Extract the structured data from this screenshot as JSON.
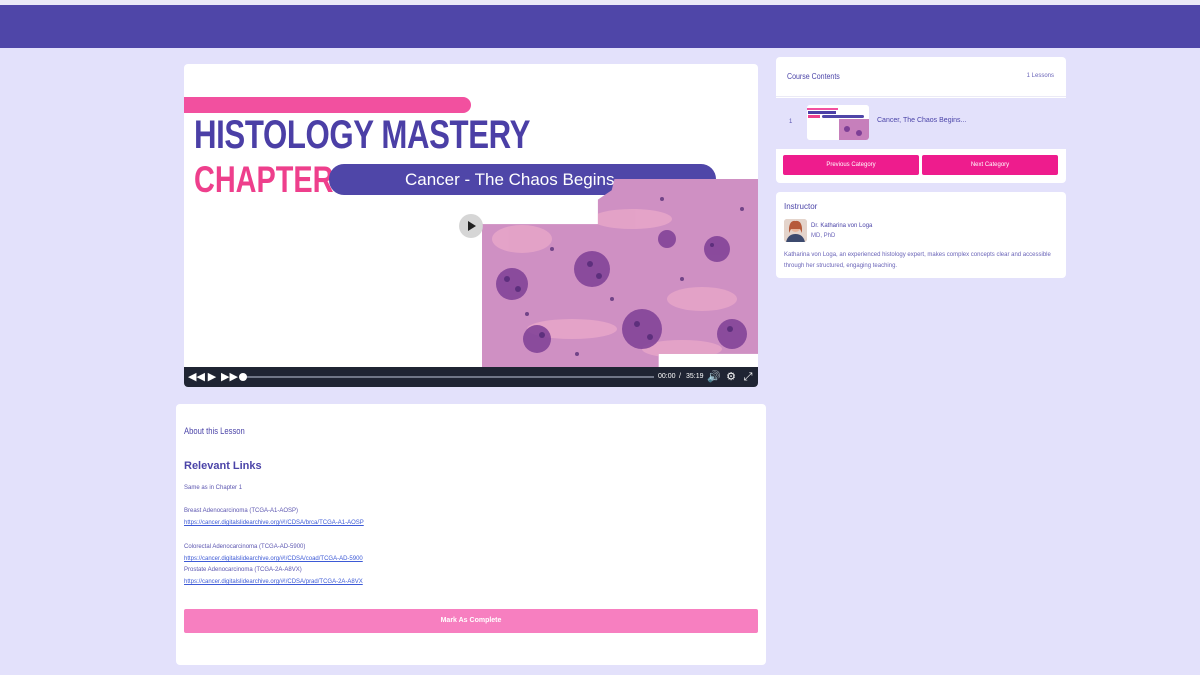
{
  "colors": {
    "page_background": "#e3e1fb",
    "header": "#4f46a8",
    "pink_accent": "#ee1c8d",
    "mark_complete": "#f77fc0"
  },
  "video": {
    "title": "HISTOLOGY MASTERY",
    "chapter": "CHAPTER 2",
    "subtitle": "Cancer - The Chaos Begins ...",
    "current_time": "00:00",
    "separator": "/",
    "duration": "35:19",
    "progress": 0,
    "icons": [
      "rewind-icon",
      "play-icon",
      "fast-forward-icon",
      "volume-icon",
      "settings-icon",
      "fullscreen-icon"
    ]
  },
  "about": {
    "title": "About this Lesson",
    "relevant_links_title": "Relevant Links",
    "note": "Same as in Chapter 1",
    "links": [
      {
        "label": "Breast Adenocarcinoma (TCGA-A1-AOSP)",
        "url": "https://cancer.digitalslidearchive.org/#!/CDSA/brca/TCGA-A1-AOSP"
      },
      {
        "label": "Colorectal Adenocarcinoma (TCGA-AD-5900)",
        "url": "https://cancer.digitalslidearchive.org/#!/CDSA/coad/TCGA-AD-5900"
      },
      {
        "label": "Prostate Adenocarcinoma (TCGA-2A-A8VX)",
        "url": "https://cancer.digitalslidearchive.org/#!/CDSA/prad/TCGA-2A-A8VX"
      }
    ],
    "mark_complete": "Mark As Complete"
  },
  "course_contents": {
    "title": "Course Contents",
    "count": "1 Lessons",
    "lessons": [
      {
        "number": "1",
        "title": "Cancer, The Chaos Begins..."
      }
    ],
    "previous": "Previous Category",
    "next": "Next Category"
  },
  "instructor": {
    "title": "Instructor",
    "name": "Dr. Katharina von Loga",
    "credentials": "MD, PhD",
    "bio": "Katharina von Loga, an experienced histology expert, makes complex concepts clear and accessible through her structured, engaging teaching."
  }
}
